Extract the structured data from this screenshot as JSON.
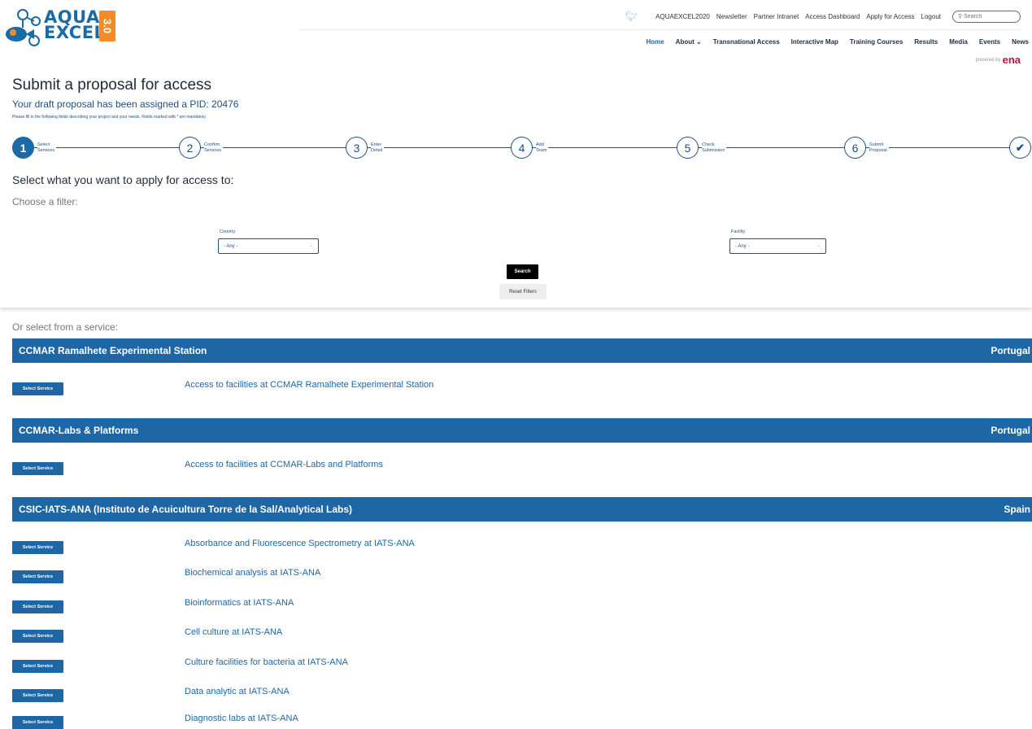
{
  "brand": {
    "logo_line1": "AQUA",
    "logo_line2": "EXCEL",
    "logo_badge": "3.0"
  },
  "topbar": {
    "links": [
      "AQUAEXCEL2020",
      "Newsletter",
      "Partner Intranet",
      "Access Dashboard",
      "Apply for Access",
      "Logout"
    ],
    "search_placeholder": "Search"
  },
  "mainnav": {
    "items": [
      "Home",
      "About ⌄",
      "Transnational Access",
      "Interactive Map",
      "Training Courses",
      "Results",
      "Media",
      "Events",
      "News"
    ],
    "active_index": 0
  },
  "powered_by": {
    "label": "powered by",
    "brand": "ena"
  },
  "page": {
    "title": "Submit a proposal for access",
    "pid_line": "Your draft proposal has been assigned a PID: 20476",
    "helper": "Please fill in the following fields describing your project and your needs. Fields marked with * are mandatory"
  },
  "stepper": {
    "steps": [
      {
        "number": "1",
        "label_line1": "Select",
        "label_line2": "Services"
      },
      {
        "number": "2",
        "label_line1": "Confirm",
        "label_line2": "Services"
      },
      {
        "number": "3",
        "label_line1": "Enter",
        "label_line2": "Detail"
      },
      {
        "number": "4",
        "label_line1": "Add",
        "label_line2": "Team"
      },
      {
        "number": "5",
        "label_line1": "Check",
        "label_line2": "Submission"
      },
      {
        "number": "6",
        "label_line1": "Submit",
        "label_line2": "Proposal"
      }
    ],
    "final_glyph": "✔",
    "active_index": 0
  },
  "filters": {
    "heading": "Select what you want to apply for access to:",
    "subheading": "Choose a filter:",
    "country_label": "Country",
    "country_value": "- Any -",
    "facility_label": "Facility",
    "facility_value": "- Any -",
    "search_button": "Search",
    "reset_button": "Reset Filters"
  },
  "services_intro": "Or select from a service:",
  "select_button_label": "Select Service",
  "groups": [
    {
      "name": "CCMAR Ramalhete Experimental Station",
      "country": "Portugal",
      "services": [
        "Access to facilities at CCMAR Ramalhete Experimental Station"
      ]
    },
    {
      "name": "CCMAR-Labs & Platforms",
      "country": "Portugal",
      "services": [
        "Access to facilities at CCMAR-Labs and Platforms"
      ]
    },
    {
      "name": "CSIC-IATS-ANA (Instituto de Acuicultura Torre de la Sal/Analytical Labs)",
      "country": "Spain",
      "services": [
        "Absorbance and Fluorescence Spectrometry at IATS-ANA",
        "Biochemical analysis at IATS-ANA",
        "Bioinformatics at IATS-ANA",
        "Cell culture at IATS-ANA",
        "Culture facilities for bacteria at IATS-ANA",
        "Data analytic at IATS-ANA",
        "Diagnostic labs at IATS-ANA"
      ]
    }
  ],
  "colors": {
    "brand_blue": "#1e67a6",
    "dark_navy": "#1f4f80",
    "logo_orange": "#f28c28",
    "ena_red": "#c0143c"
  }
}
